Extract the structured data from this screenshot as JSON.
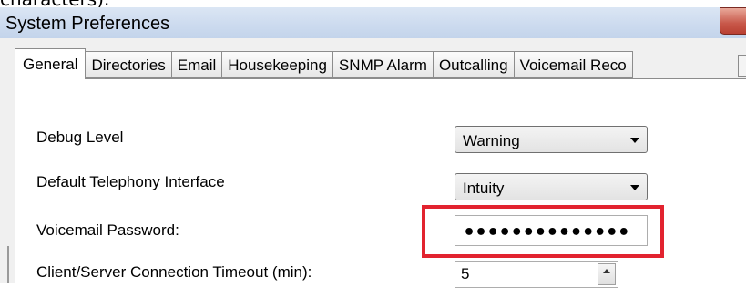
{
  "top_fragment": "characters).",
  "window": {
    "title": "System Preferences"
  },
  "tabs": [
    "General",
    "Directories",
    "Email",
    "Housekeeping",
    "SNMP Alarm",
    "Outcalling",
    "Voicemail Reco"
  ],
  "fields": {
    "debug_level": {
      "label": "Debug Level",
      "value": "Warning"
    },
    "default_telephony": {
      "label": "Default Telephony Interface",
      "value": "Intuity"
    },
    "voicemail_password": {
      "label": "Voicemail Password:",
      "value": "••••••••••••••"
    },
    "connection_timeout": {
      "label": "Client/Server Connection Timeout (min):",
      "value": "5"
    }
  },
  "colors": {
    "highlight": "#e2232f",
    "titlebar": "#cddbef"
  }
}
